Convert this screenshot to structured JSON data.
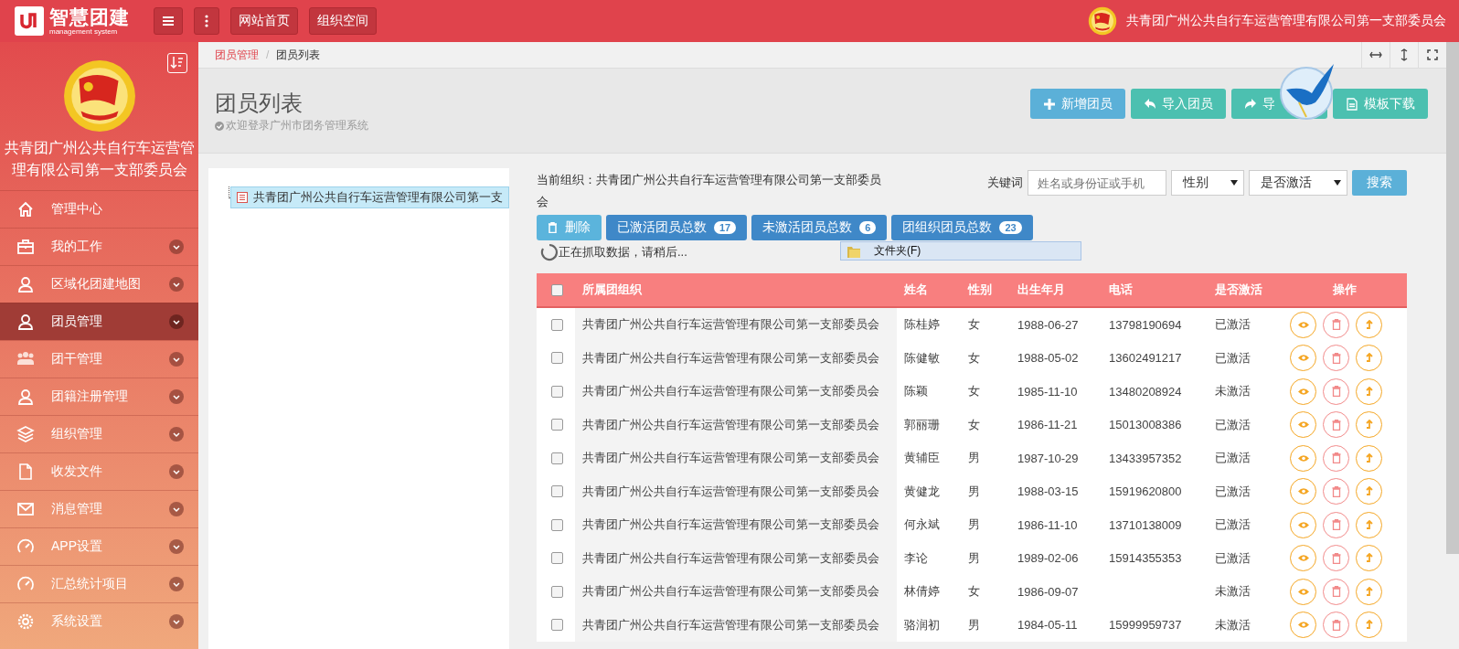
{
  "topbar": {
    "logo_title": "智慧团建",
    "logo_subtitle": "management system",
    "buttons": [
      {
        "kind": "menu"
      },
      {
        "kind": "more"
      },
      {
        "kind": "text",
        "label": "网站首页"
      },
      {
        "kind": "text",
        "label": "组织空间"
      }
    ],
    "org_name": "共青团广州公共自行车运营管理有限公司第一支部委员会"
  },
  "sidebar": {
    "org_name": "共青团广州公共自行车运营管理有限公司第一支部委员会",
    "items": [
      {
        "label": "管理中心",
        "kind": "home",
        "has_submenu": false,
        "selected": false
      },
      {
        "label": "我的工作",
        "kind": "briefcase",
        "has_submenu": true,
        "selected": false
      },
      {
        "label": "区域化团建地图",
        "kind": "user",
        "has_submenu": true,
        "selected": false
      },
      {
        "label": "团员管理",
        "kind": "user",
        "has_submenu": true,
        "selected": true
      },
      {
        "label": "团干管理",
        "kind": "group",
        "has_submenu": true,
        "selected": false
      },
      {
        "label": "团籍注册管理",
        "kind": "user",
        "has_submenu": true,
        "selected": false
      },
      {
        "label": "组织管理",
        "kind": "layers",
        "has_submenu": true,
        "selected": false
      },
      {
        "label": "收发文件",
        "kind": "file",
        "has_submenu": true,
        "selected": false
      },
      {
        "label": "消息管理",
        "kind": "mail",
        "has_submenu": true,
        "selected": false
      },
      {
        "label": "APP设置",
        "kind": "gauge",
        "has_submenu": true,
        "selected": false
      },
      {
        "label": "汇总统计项目",
        "kind": "gauge",
        "has_submenu": true,
        "selected": false
      },
      {
        "label": "系统设置",
        "kind": "gear",
        "has_submenu": true,
        "selected": false
      }
    ]
  },
  "breadcrumb": {
    "items": [
      "团员管理",
      "团员列表"
    ],
    "separator": "/"
  },
  "page_header": {
    "title": "团员列表",
    "subtitle": "欢迎登录广州市团务管理系统",
    "actions": [
      {
        "label": "新增团员",
        "kind": "add"
      },
      {
        "label": "导入团员",
        "kind": "import"
      },
      {
        "label": "导",
        "kind": "export"
      },
      {
        "label": "模板下载",
        "kind": "template"
      }
    ]
  },
  "tree": {
    "items": [
      {
        "label": "共青团广州公共自行车运营管理有限公司第一支",
        "selected": true
      }
    ]
  },
  "current_org": "当前组织：共青团广州公共自行车运营管理有限公司第一支部委员会",
  "filters": {
    "keyword_label": "关键词",
    "keyword_placeholder": "姓名或身份证或手机",
    "gender": "性别",
    "activated": "是否激活",
    "search": "搜索"
  },
  "toolbar": {
    "delete": "删除",
    "counts": [
      {
        "label": "已激活团员总数",
        "count": "17"
      },
      {
        "label": "未激活团员总数",
        "count": "6"
      },
      {
        "label": "团组织团员总数",
        "count": "23"
      }
    ]
  },
  "loading": "正在抓取数据，请稍后...",
  "popup": {
    "label": "文件夹(F)"
  },
  "table": {
    "select_all_checked": false,
    "columns": [
      "所属团组织",
      "姓名",
      "性别",
      "出生年月",
      "电话",
      "是否激活",
      "操作"
    ],
    "rows": [
      {
        "checked": false,
        "cells": [
          "共青团广州公共自行车运营管理有限公司第一支部委员会",
          "陈桂婷",
          "女",
          "1988-06-27",
          "13798190694",
          "已激活"
        ]
      },
      {
        "checked": false,
        "cells": [
          "共青团广州公共自行车运营管理有限公司第一支部委员会",
          "陈健敏",
          "女",
          "1988-05-02",
          "13602491217",
          "已激活"
        ]
      },
      {
        "checked": false,
        "cells": [
          "共青团广州公共自行车运营管理有限公司第一支部委员会",
          "陈颖",
          "女",
          "1985-11-10",
          "13480208924",
          "未激活"
        ]
      },
      {
        "checked": false,
        "cells": [
          "共青团广州公共自行车运营管理有限公司第一支部委员会",
          "郭丽珊",
          "女",
          "1986-11-21",
          "15013008386",
          "已激活"
        ]
      },
      {
        "checked": false,
        "cells": [
          "共青团广州公共自行车运营管理有限公司第一支部委员会",
          "黄辅臣",
          "男",
          "1987-10-29",
          "13433957352",
          "已激活"
        ]
      },
      {
        "checked": false,
        "cells": [
          "共青团广州公共自行车运营管理有限公司第一支部委员会",
          "黄健龙",
          "男",
          "1988-03-15",
          "15919620800",
          "已激活"
        ]
      },
      {
        "checked": false,
        "cells": [
          "共青团广州公共自行车运营管理有限公司第一支部委员会",
          "何永斌",
          "男",
          "1986-11-10",
          "13710138009",
          "已激活"
        ]
      },
      {
        "checked": false,
        "cells": [
          "共青团广州公共自行车运营管理有限公司第一支部委员会",
          "李论",
          "男",
          "1989-02-06",
          "15914355353",
          "已激活"
        ]
      },
      {
        "checked": false,
        "cells": [
          "共青团广州公共自行车运营管理有限公司第一支部委员会",
          "林倩婷",
          "女",
          "1986-09-07",
          "",
          "未激活"
        ]
      },
      {
        "checked": false,
        "cells": [
          "共青团广州公共自行车运营管理有限公司第一支部委员会",
          "骆润初",
          "男",
          "1984-05-11",
          "15999959737",
          "未激活"
        ]
      }
    ]
  }
}
